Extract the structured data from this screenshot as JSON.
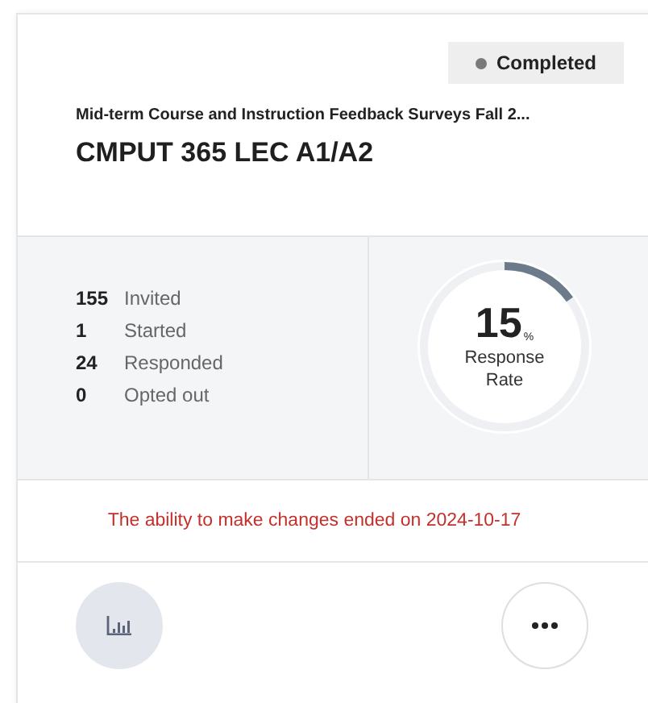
{
  "status": {
    "label": "Completed",
    "color": "#7a7a7a"
  },
  "survey": "Mid-term Course and Instruction Feedback Surveys Fall 2...",
  "course": "CMPUT 365 LEC A1/A2",
  "stats": [
    {
      "value": "155",
      "label": "Invited"
    },
    {
      "value": "1",
      "label": "Started"
    },
    {
      "value": "24",
      "label": "Responded"
    },
    {
      "value": "0",
      "label": "Opted out"
    }
  ],
  "response": {
    "number": "15",
    "unit": "%",
    "label": "Response Rate",
    "level": 0.15
  },
  "notice": "The ability to make changes ended on 2024-10-17",
  "actions": [
    {
      "kind": "report"
    },
    {
      "kind": "more"
    }
  ]
}
